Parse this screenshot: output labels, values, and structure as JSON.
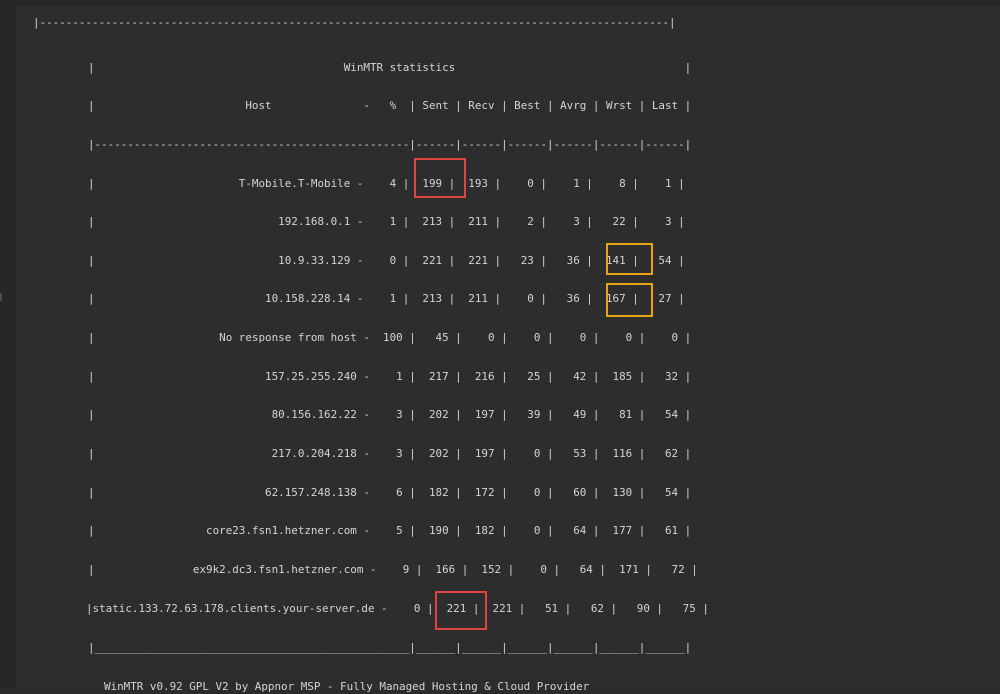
{
  "report": {
    "top_border": "|------------------------------------------------------------------------------------------------|",
    "title_line": "|                                      WinMTR statistics                                   |",
    "header_line": "|                       Host              -   %  | Sent | Recv | Best | Avrg | Wrst | Last |",
    "separator_line": "|------------------------------------------------|------|------|------|------|------|------|",
    "rows": [
      "|                      T-Mobile.T-Mobile -    4 |  199 |  193 |    0 |    1 |    8 |    1 |",
      "|                            192.168.0.1 -    1 |  213 |  211 |    2 |    3 |   22 |    3 |",
      "|                            10.9.33.129 -    0 |  221 |  221 |   23 |   36 |  141 |   54 |",
      "|                          10.158.228.14 -    1 |  213 |  211 |    0 |   36 |  167 |   27 |",
      "|                   No response from host -  100 |   45 |    0 |    0 |    0 |    0 |    0 |",
      "|                          157.25.255.240 -    1 |  217 |  216 |   25 |   42 |  185 |   32 |",
      "|                           80.156.162.22 -    3 |  202 |  197 |   39 |   49 |   81 |   54 |",
      "|                           217.0.204.218 -    3 |  202 |  197 |    0 |   53 |  116 |   62 |",
      "|                          62.157.248.138 -    6 |  182 |  172 |    0 |   60 |  130 |   54 |",
      "|                 core23.fsn1.hetzner.com -    5 |  190 |  182 |    0 |   64 |  177 |   61 |",
      "|               ex9k2.dc3.fsn1.hetzner.com -    9 |  166 |  152 |    0 |   64 |  171 |   72 |",
      "|static.133.72.63.178.clients.your-server.de -    0 |  221 |  221 |   51 |   62 |   90 |   75 |"
    ],
    "bottom_border": "|________________________________________________|______|______|______|______|______|______|",
    "footer_line": "WinMTR v0.92 GPL V2 by Appnor MSP - Fully Managed Hosting & Cloud Provider"
  },
  "highlights": [
    {
      "color": "#e0443e",
      "target": "T-Mobile.T-Mobile Sent 199"
    },
    {
      "color": "#e8a317",
      "target": "10.9.33.129 Wrst 141"
    },
    {
      "color": "#e8a317",
      "target": "10.158.228.14 Wrst 167"
    },
    {
      "color": "#e0443e",
      "target": "static.133.72.63.178.clients.your-server.de Sent 221"
    }
  ]
}
